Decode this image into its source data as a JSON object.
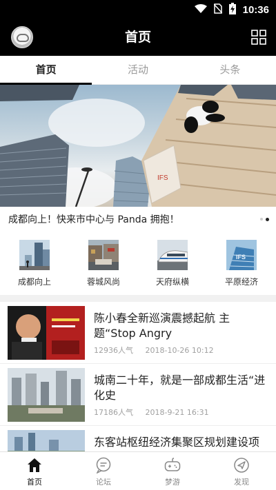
{
  "status_bar": {
    "time": "10:36",
    "icons": [
      "wifi-icon",
      "no-sim-icon",
      "battery-charging-icon"
    ]
  },
  "header": {
    "title": "首页",
    "avatar_icon": "avatar-icon",
    "menu_icon": "grid-icon"
  },
  "tabs": [
    {
      "label": "首页",
      "active": true
    },
    {
      "label": "活动",
      "active": false
    },
    {
      "label": "头条",
      "active": false
    }
  ],
  "banner": {
    "caption": "成都向上！快来市中心与 Panda 拥抱！",
    "slide_count": 2,
    "active_slide": 2
  },
  "categories": [
    {
      "label": "成都向上",
      "icon": "city-photo"
    },
    {
      "label": "蓉城风尚",
      "icon": "street-photo"
    },
    {
      "label": "天府纵横",
      "icon": "train-photo"
    },
    {
      "label": "平原经济",
      "icon": "building-photo"
    }
  ],
  "news": [
    {
      "title": "陈小春全新巡演震撼起航 主题“Stop Angry",
      "views": "12936人气",
      "date": "2018-10-26 10:12"
    },
    {
      "title": "城南二十年，就是一部成都生活“进化史",
      "views": "17186人气",
      "date": "2018-9-21 16:31"
    },
    {
      "title": "东客站枢纽经济集聚区规划建设项目",
      "views": "",
      "date": ""
    }
  ],
  "bottom_nav": [
    {
      "label": "首页",
      "icon": "home-icon",
      "active": true
    },
    {
      "label": "论坛",
      "icon": "chat-icon",
      "active": false
    },
    {
      "label": "梦游",
      "icon": "gamepad-icon",
      "active": false
    },
    {
      "label": "发现",
      "icon": "compass-icon",
      "active": false
    }
  ]
}
